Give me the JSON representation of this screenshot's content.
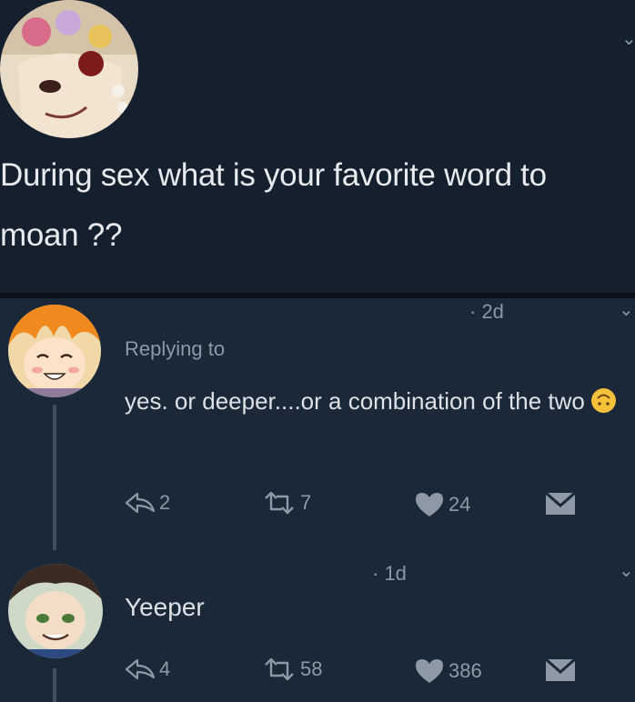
{
  "original_tweet": {
    "text": "During sex what is your favorite word to moan ??"
  },
  "reply_1": {
    "time": "· 2d",
    "replying_to": "Replying to",
    "text": "yes. or deeper....or a combination of the two",
    "emoji": "upside-down-face",
    "actions": {
      "replies": "2",
      "retweets": "7",
      "likes": "24"
    }
  },
  "reply_2": {
    "time": "· 1d",
    "text": "Yeeper",
    "actions": {
      "replies": "4",
      "retweets": "58",
      "likes": "386"
    }
  },
  "colors": {
    "background": "#15202b",
    "text": "#e8ebee",
    "muted": "#8d9aa6"
  }
}
